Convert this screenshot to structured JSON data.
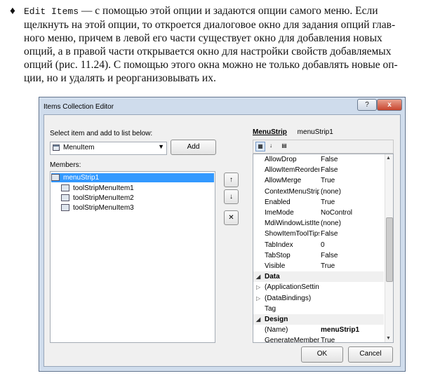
{
  "paragraph": {
    "bullet": "♦",
    "term": "Edit Items",
    "lines": [
      " — с помощью этой опции и задаются опции самого меню. Если",
      "щелкнуть на этой опции, то откроется диалоговое окно для задания опций глав-",
      "ного меню, причем в левой его части существует окно для добавления новых",
      "опций, а в правой части открывается окно для настройки свойств добавляемых",
      "опций (рис. 11.24). С помощью этого окна можно не только добавлять новые оп-",
      "ции, но и удалять и реорганизовывать их."
    ]
  },
  "dialog": {
    "title": "Items Collection Editor",
    "help_label": "?",
    "close_label": "x",
    "select_label": "Select item and add to list below:",
    "combo_value": "MenuItem",
    "add_label": "Add",
    "members_label": "Members:",
    "members": [
      "menuStrip1",
      "toolStripMenuItem1",
      "toolStripMenuItem2",
      "toolStripMenuItem3"
    ],
    "up_icon": "↑",
    "down_icon": "↓",
    "remove_icon": "✕",
    "object_type": "MenuStrip",
    "object_name": "menuStrip1",
    "properties": [
      {
        "name": "AllowDrop",
        "value": "False"
      },
      {
        "name": "AllowItemReorder",
        "value": "False"
      },
      {
        "name": "AllowMerge",
        "value": "True"
      },
      {
        "name": "ContextMenuStrip",
        "value": "(none)"
      },
      {
        "name": "Enabled",
        "value": "True"
      },
      {
        "name": "ImeMode",
        "value": "NoControl"
      },
      {
        "name": "MdiWindowListItem",
        "value": "(none)"
      },
      {
        "name": "ShowItemToolTips",
        "value": "False"
      },
      {
        "name": "TabIndex",
        "value": "0"
      },
      {
        "name": "TabStop",
        "value": "False"
      },
      {
        "name": "Visible",
        "value": "True"
      },
      {
        "name": "Data",
        "value": "",
        "category": true,
        "glyph": "◢"
      },
      {
        "name": "(ApplicationSettings)",
        "value": "",
        "glyph": "▷"
      },
      {
        "name": "(DataBindings)",
        "value": "",
        "glyph": "▷"
      },
      {
        "name": "Tag",
        "value": ""
      },
      {
        "name": "Design",
        "value": "",
        "category": true,
        "glyph": "◢"
      },
      {
        "name": "(Name)",
        "value": "menuStrip1",
        "bold": true
      },
      {
        "name": "GenerateMember",
        "value": "True"
      }
    ],
    "ok_label": "OK",
    "cancel_label": "Cancel"
  }
}
